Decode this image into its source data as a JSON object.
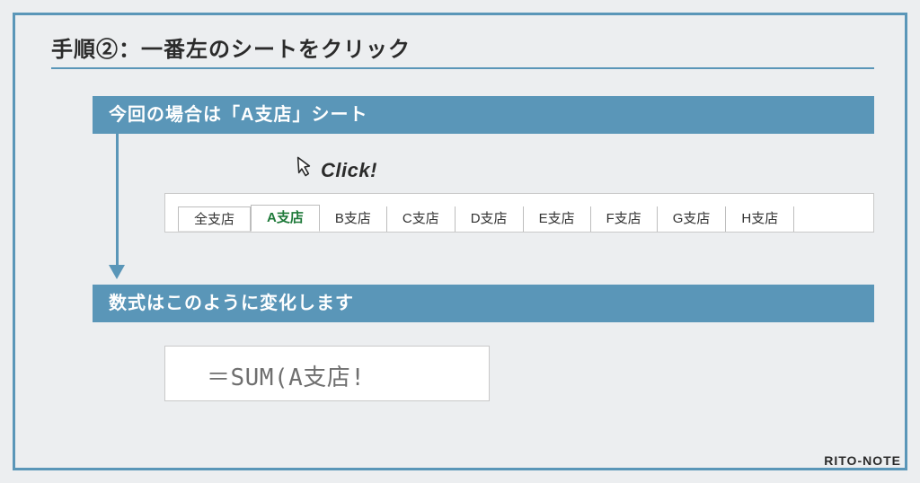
{
  "title": "手順②：一番左のシートをクリック",
  "bar1": "今回の場合は「A支店」シート",
  "bar2": "数式はこのように変化します",
  "click_label": "Click!",
  "tabs": [
    "全支店",
    "A支店",
    "B支店",
    "C支店",
    "D支店",
    "E支店",
    "F支店",
    "G支店",
    "H支店"
  ],
  "active_tab_index": 1,
  "formula": "＝SUM(A支店!",
  "watermark": "RITO-NOTE"
}
